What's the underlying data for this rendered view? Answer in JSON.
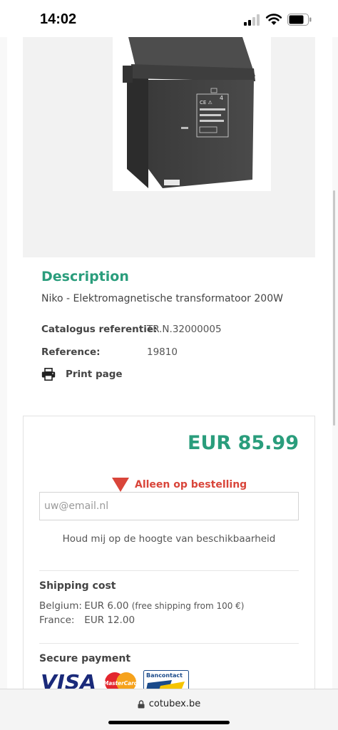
{
  "status_bar": {
    "time": "14:02"
  },
  "product": {
    "description_title": "Description",
    "description_text": "Niko - Elektromagnetische transformatoor 200W",
    "specs": [
      {
        "label": "Catalogus referentie:",
        "value": "TR.N.32000005"
      },
      {
        "label": "Reference:",
        "value": "19810"
      }
    ],
    "print_label": "Print page"
  },
  "buy_box": {
    "price": "EUR 85.99",
    "availability": "Alleen op bestelling",
    "email_placeholder": "uw@email.nl",
    "notify_text": "Houd mij op de hoogte van beschikbaarheid",
    "shipping": {
      "title": "Shipping cost",
      "lines": [
        {
          "country": "Belgium:",
          "price": "EUR 6.00",
          "note": "(free shipping from 100 €)"
        },
        {
          "country": "France:",
          "price": "EUR 12.00",
          "note": ""
        }
      ]
    },
    "payment": {
      "title": "Secure payment",
      "logos": [
        "VISA",
        "MasterCard",
        "Bancontact"
      ]
    }
  },
  "browser": {
    "url": "cotubex.be"
  },
  "colors": {
    "accent": "#2a9d7c",
    "alert": "#d9453a"
  }
}
